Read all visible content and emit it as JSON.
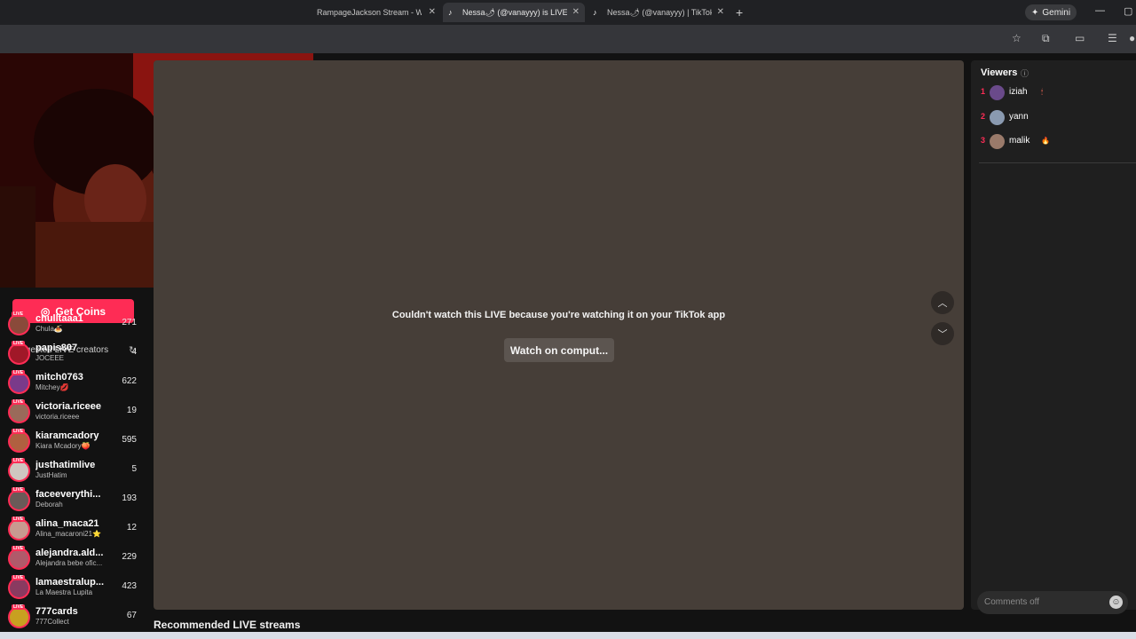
{
  "browser": {
    "tabs": [
      {
        "title": "RampageJackson Stream - Watch",
        "active": false
      },
      {
        "title": "Nessa🌶 (@vanayyy) is LIVE - TikTok",
        "active": true
      },
      {
        "title": "Nessa🌶 (@vanayyy) | TikTok",
        "active": false
      }
    ],
    "new_tab": "+",
    "gemini_label": "Gemini",
    "window_controls": {
      "minimize": "—",
      "maximize": "▢"
    }
  },
  "sidebar": {
    "get_coins_label": "Get Coins",
    "suggested_title": "Suggested LIVE creators",
    "live_tag": "LIVE",
    "creators": [
      {
        "name": "chulltaaa1",
        "sub": "Chula🍝",
        "count": "271",
        "color": "#8a4a3a"
      },
      {
        "name": "papis807",
        "sub": "JOCEEE",
        "count": "4",
        "color": "#a01828"
      },
      {
        "name": "mitch0763",
        "sub": "Mitchey💋",
        "count": "622",
        "color": "#7a3a8a"
      },
      {
        "name": "victoria.riceee",
        "sub": "victoria.riceee",
        "count": "19",
        "color": "#9a6a5a"
      },
      {
        "name": "kiaramcadory",
        "sub": "Kiara Mcadory🍑",
        "count": "595",
        "color": "#b06040"
      },
      {
        "name": "justhatimlive",
        "sub": "JustHatim",
        "count": "5",
        "color": "#cfc6c0"
      },
      {
        "name": "faceeverythi...",
        "sub": "Deborah",
        "count": "193",
        "color": "#6a5a58"
      },
      {
        "name": "alina_maca21",
        "sub": "Alina_macaroni21⭐",
        "count": "12",
        "color": "#c89a90"
      },
      {
        "name": "alejandra.ald...",
        "sub": "Alejandra bebe ofic...",
        "count": "229",
        "color": "#b05a6a"
      },
      {
        "name": "lamaestralup...",
        "sub": "La Maestra Lupita",
        "count": "423",
        "color": "#8a3a60"
      },
      {
        "name": "777cards",
        "sub": "777Collect",
        "count": "67",
        "color": "#c8a020"
      }
    ]
  },
  "player": {
    "message": "Couldn't watch this LIVE because you're watching it on your TikTok app",
    "watch_button": "Watch on comput..."
  },
  "recommended_title": "Recommended LIVE streams",
  "viewers": {
    "title": "Viewers",
    "list": [
      {
        "rank": "1",
        "name": "iziah",
        "badge": "🕯",
        "color": "#6a4a8a"
      },
      {
        "rank": "2",
        "name": "yann",
        "badge": "",
        "color": "#8a9ab0"
      },
      {
        "rank": "3",
        "name": "malik",
        "badge": "🔥",
        "color": "#9a7a6a"
      }
    ],
    "comments_placeholder": "Comments off"
  }
}
